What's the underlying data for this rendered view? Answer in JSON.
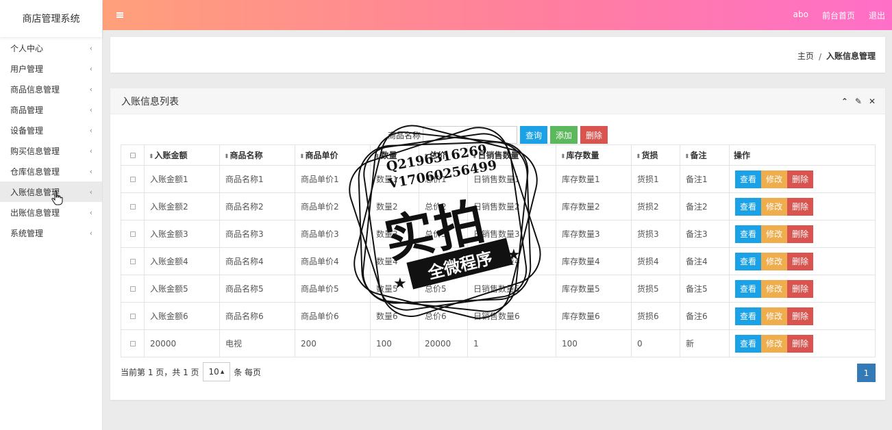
{
  "sidebar": {
    "brand": "商店管理系统",
    "items": [
      {
        "label": "个人中心",
        "active": false
      },
      {
        "label": "用户管理",
        "active": false
      },
      {
        "label": "商品信息管理",
        "active": false
      },
      {
        "label": "商品管理",
        "active": false
      },
      {
        "label": "设备管理",
        "active": false
      },
      {
        "label": "购买信息管理",
        "active": false
      },
      {
        "label": "仓库信息管理",
        "active": false
      },
      {
        "label": "入账信息管理",
        "active": true
      },
      {
        "label": "出账信息管理",
        "active": false
      },
      {
        "label": "系统管理",
        "active": false
      }
    ],
    "chevron": "‹"
  },
  "header": {
    "user": "abo",
    "frontpage": "前台首页",
    "logout": "退出"
  },
  "breadcrumb": {
    "home": "主页",
    "separator": "/",
    "current": "入账信息管理"
  },
  "panel": {
    "title": "入账信息列表",
    "tools": {
      "collapse": "⌃",
      "settings": "✎",
      "close": "✕"
    }
  },
  "search": {
    "label": "商品名称",
    "value": "",
    "placeholder": "",
    "query_btn": "查询",
    "add_btn": "添加",
    "delete_btn": "删除"
  },
  "table": {
    "columns": [
      "入账金额",
      "商品名称",
      "商品单价",
      "数量",
      "总价",
      "日销售数量",
      "库存数量",
      "货损",
      "备注"
    ],
    "ops_header": "操作",
    "sort_icon": "⬍",
    "rows": [
      [
        "入账金额1",
        "商品名称1",
        "商品单价1",
        "数量1",
        "总价1",
        "日销售数量1",
        "库存数量1",
        "货损1",
        "备注1"
      ],
      [
        "入账金额2",
        "商品名称2",
        "商品单价2",
        "数量2",
        "总价2",
        "日销售数量2",
        "库存数量2",
        "货损2",
        "备注2"
      ],
      [
        "入账金额3",
        "商品名称3",
        "商品单价3",
        "数量3",
        "总价3",
        "日销售数量3",
        "库存数量3",
        "货损3",
        "备注3"
      ],
      [
        "入账金额4",
        "商品名称4",
        "商品单价4",
        "数量4",
        "总价4",
        "日销售数量4",
        "库存数量4",
        "货损4",
        "备注4"
      ],
      [
        "入账金额5",
        "商品名称5",
        "商品单价5",
        "数量5",
        "总价5",
        "日销售数量5",
        "库存数量5",
        "货损5",
        "备注5"
      ],
      [
        "入账金额6",
        "商品名称6",
        "商品单价6",
        "数量6",
        "总价6",
        "日销售数量6",
        "库存数量6",
        "货损6",
        "备注6"
      ],
      [
        "20000",
        "电视",
        "200",
        "100",
        "20000",
        "1",
        "100",
        "0",
        "新"
      ]
    ],
    "op_view": "查看",
    "op_edit": "修改",
    "op_delete": "删除"
  },
  "pager": {
    "summary": "当前第 1 页，共 1 页",
    "page_size": "10",
    "per_page": "条 每页",
    "current_page": "1"
  },
  "watermark": {
    "line1": "Q2196316269",
    "line2": "V17060256499",
    "big": "实拍",
    "ribbon": "全微程序"
  },
  "colors": {
    "header_start": "#ffa07a",
    "header_end": "#ff6fc8",
    "blue": "#1aa1e6",
    "green": "#5cb85c",
    "red": "#d9534f",
    "orange": "#f0ad4e",
    "page_active": "#337ab7"
  }
}
